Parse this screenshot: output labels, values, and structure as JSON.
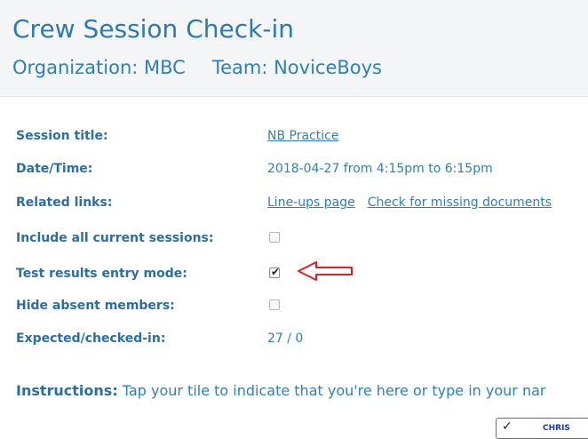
{
  "header": {
    "title": "Crew Session Check-in",
    "organization": "Organization: MBC",
    "team": "Team: NoviceBoys"
  },
  "fields": {
    "session_title": {
      "label": "Session title:",
      "value": "NB Practice"
    },
    "date_time": {
      "label": "Date/Time:",
      "value": "2018-04-27 from 4:15pm to 6:15pm"
    },
    "related_links": {
      "label": "Related links:",
      "links": [
        "Line-ups page",
        "Check for missing documents"
      ]
    },
    "include_all": {
      "label": "Include all current sessions:",
      "checked": false
    },
    "test_results": {
      "label": "Test results entry mode:",
      "checked": true
    },
    "hide_absent": {
      "label": "Hide absent members:",
      "checked": false
    },
    "expected": {
      "label": "Expected/checked-in:",
      "value": "27 / 0"
    }
  },
  "instructions": {
    "lead": "Instructions:",
    "text": " Tap your tile to indicate that you're here or type in your nar"
  },
  "corner_tile": {
    "text": "CHRIS"
  },
  "colors": {
    "primary_text": "#2f7fb8",
    "label_text": "#2a6ea8",
    "header_bg": "#f3f5f7",
    "annotation_arrow": "#e02020"
  },
  "icons": {
    "checkmark": "check-icon",
    "annotation": "red-arrow-annotation-icon"
  }
}
